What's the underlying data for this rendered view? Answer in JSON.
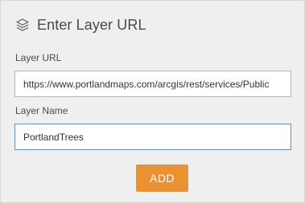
{
  "header": {
    "icon": "layers-icon",
    "title": "Enter Layer URL"
  },
  "form": {
    "layer_url": {
      "label": "Layer URL",
      "value": "https://www.portlandmaps.com/arcgis/rest/services/Public"
    },
    "layer_name": {
      "label": "Layer Name",
      "value": "PortlandTrees"
    },
    "add_button_label": "ADD"
  },
  "colors": {
    "accent": "#ea9131",
    "panel_background": "#efefef",
    "focused_border": "#6b8fb8"
  }
}
